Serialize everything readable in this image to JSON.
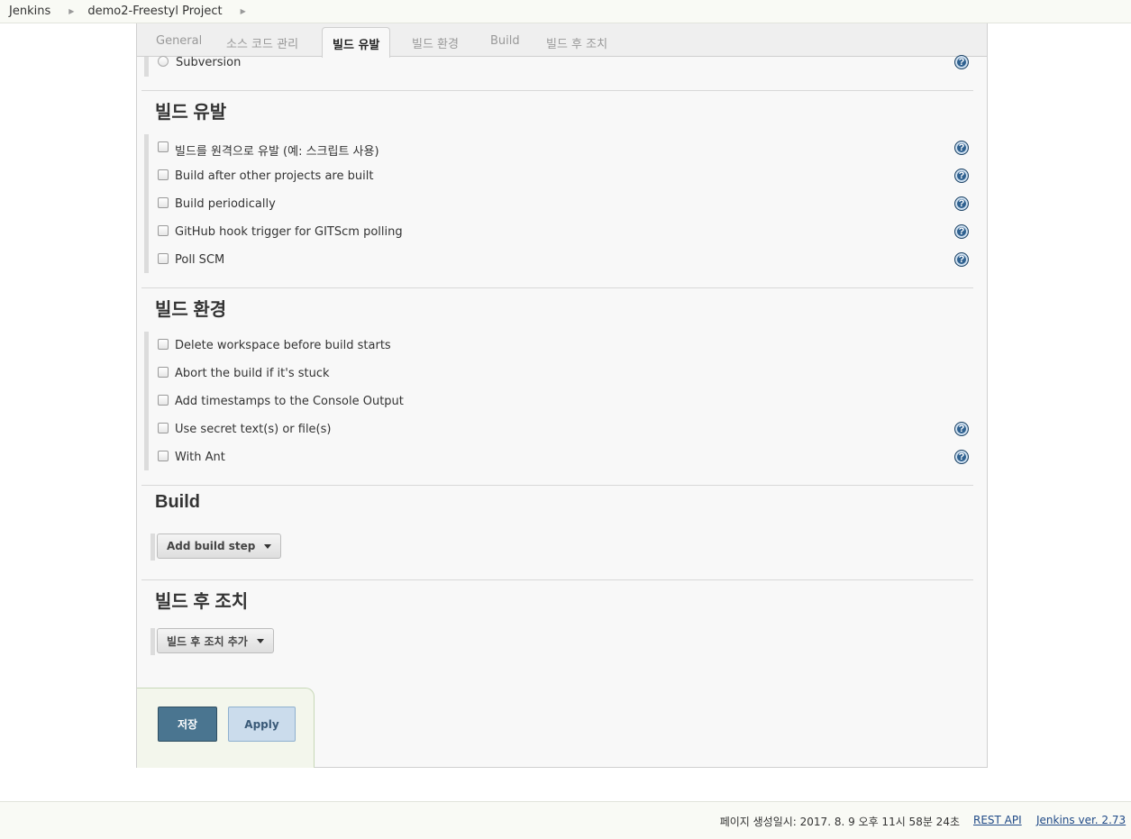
{
  "breadcrumb": {
    "items": [
      "Jenkins",
      "demo2-Freestyl Project"
    ]
  },
  "tabs": [
    {
      "label": "General"
    },
    {
      "label": "소스 코드 관리"
    },
    {
      "label": "빌드 유발",
      "active": true
    },
    {
      "label": "빌드 환경"
    },
    {
      "label": "Build"
    },
    {
      "label": "빌드 후 조치"
    }
  ],
  "scm": {
    "subversion_label": "Subversion"
  },
  "build_triggers": {
    "title": "빌드 유발",
    "options": [
      {
        "label": "빌드를 원격으로 유발 (예: 스크립트 사용)",
        "checked": false,
        "help": true
      },
      {
        "label": "Build after other projects are built",
        "checked": false,
        "help": true
      },
      {
        "label": "Build periodically",
        "checked": false,
        "help": true
      },
      {
        "label": "GitHub hook trigger for GITScm polling",
        "checked": false,
        "help": true
      },
      {
        "label": "Poll SCM",
        "checked": false,
        "help": true
      }
    ]
  },
  "build_env": {
    "title": "빌드 환경",
    "options": [
      {
        "label": "Delete workspace before build starts",
        "checked": false,
        "help": false
      },
      {
        "label": "Abort the build if it's stuck",
        "checked": false,
        "help": false
      },
      {
        "label": "Add timestamps to the Console Output",
        "checked": false,
        "help": false
      },
      {
        "label": "Use secret text(s) or file(s)",
        "checked": false,
        "help": true
      },
      {
        "label": "With Ant",
        "checked": false,
        "help": true
      }
    ]
  },
  "build": {
    "title": "Build",
    "add_step_label": "Add build step"
  },
  "post_build": {
    "title": "빌드 후 조치",
    "add_action_label": "빌드 후 조치 추가"
  },
  "actions": {
    "save_label": "저장",
    "apply_label": "Apply"
  },
  "footer": {
    "generated_text": "페이지 생성일시: 2017. 8. 9 오후 11시 58분 24초",
    "rest_api_label": "REST API",
    "version_label": "Jenkins ver. 2.73"
  },
  "icons": {
    "help": "help-question-icon",
    "breadcrumb_sep": "chevron-right-icon",
    "dropdown": "caret-down-icon"
  },
  "colors": {
    "save_button": "#4a7590",
    "apply_button": "#cbdcec",
    "help_icon": "#2f6190",
    "link": "#204a87"
  }
}
